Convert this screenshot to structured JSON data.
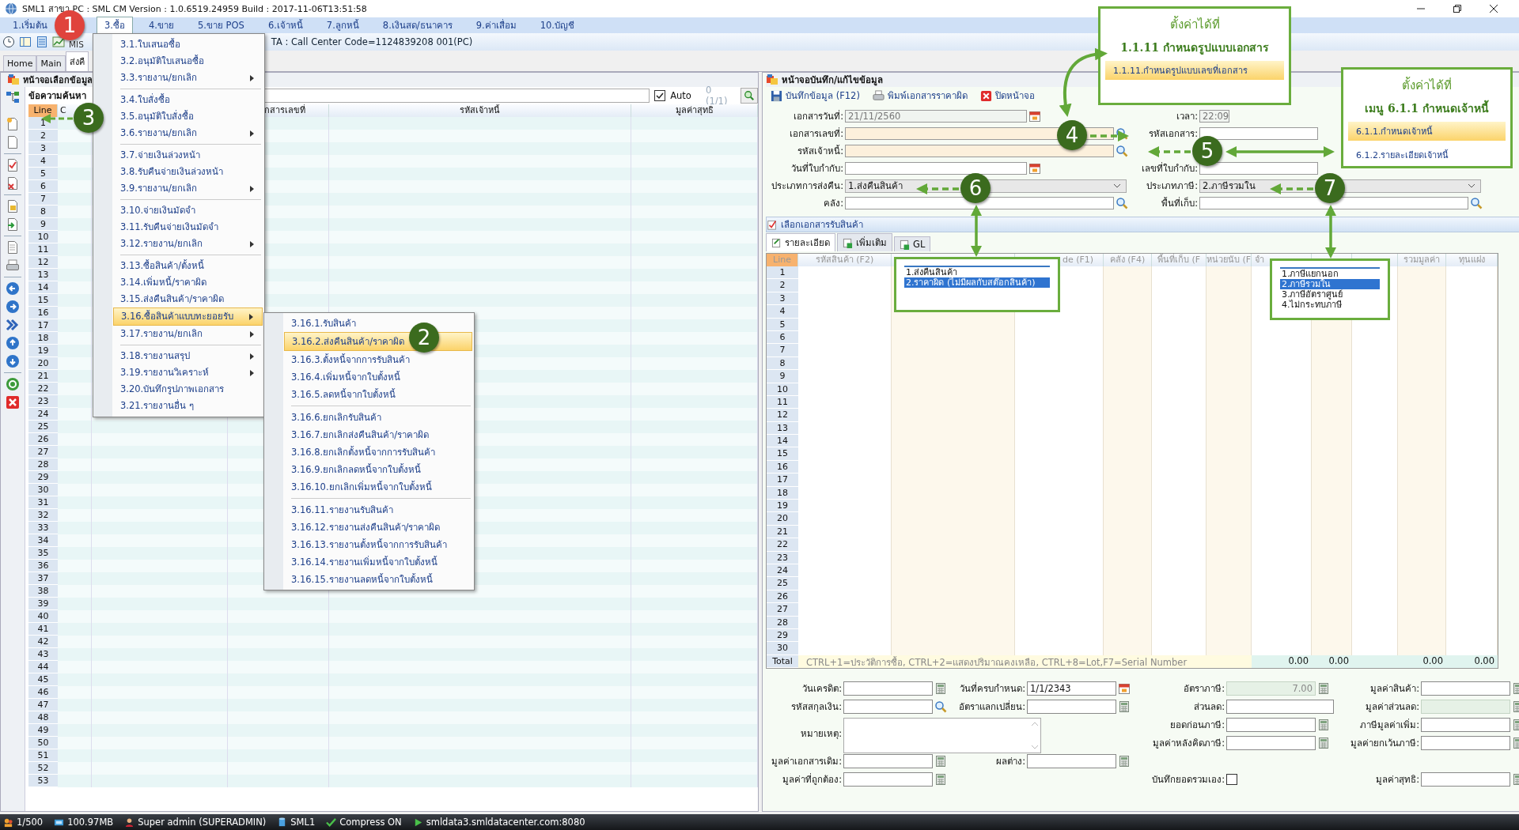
{
  "window": {
    "title": "SML1 สาขา PC : SML CM Version : 1.0.6519.24959  Build : 2017-11-06T13:51:58"
  },
  "menu_bar": [
    {
      "label": "1.เริ่มต้น",
      "selected": false
    },
    {
      "label": "3.ซื้อ",
      "selected": true
    },
    {
      "label": "4.ขาย",
      "selected": false
    },
    {
      "label": "5.ขาย POS",
      "selected": false
    },
    {
      "label": "6.เจ้าหนี้",
      "selected": false
    },
    {
      "label": "7.ลูกหนี้",
      "selected": false
    },
    {
      "label": "8.เงินสด/ธนาคาร",
      "selected": false
    },
    {
      "label": "9.ค่าเสื่อม",
      "selected": false
    },
    {
      "label": "10.บัญชี",
      "selected": false
    }
  ],
  "toolbar": {
    "mis_label": "MIS",
    "info": "TA : Call Center Code=1124839208 001(PC)"
  },
  "tabs": [
    {
      "label": "Home",
      "selected": false
    },
    {
      "label": "Main",
      "selected": false
    },
    {
      "label": "ส่งคื",
      "selected": true
    }
  ],
  "left_panel": {
    "title": "หน้าจอเลือกข้อมูล",
    "search_label": "ข้อความค้นหา",
    "auto": {
      "label": "Auto",
      "checked": true
    },
    "count": "0 (1/1)",
    "columns": [
      {
        "label": "Line"
      },
      {
        "label": "C"
      },
      {},
      {
        "label": "กสารเลขที่"
      },
      {
        "label": "รหัสเจ้าหนี้"
      },
      {
        "label": "มูลค่าสุทธิ"
      }
    ],
    "rows": [
      "1",
      "2",
      "3",
      "4",
      "5",
      "6",
      "7",
      "8",
      "9",
      "10",
      "11",
      "12",
      "13",
      "14",
      "15",
      "16",
      "17",
      "18",
      "19",
      "20",
      "21",
      "22",
      "23",
      "24",
      "25",
      "26",
      "27",
      "28",
      "29",
      "30",
      "31",
      "32",
      "33",
      "34",
      "35",
      "36",
      "37",
      "38",
      "39",
      "40",
      "41",
      "42",
      "43",
      "44",
      "45",
      "46",
      "47",
      "48",
      "49",
      "50",
      "51",
      "52",
      "53"
    ]
  },
  "dropdown_menu": [
    {
      "kind": "item",
      "label": "3.1.ใบเสนอซื้อ",
      "submenu": false,
      "selected": false
    },
    {
      "kind": "item",
      "label": "3.2.อนุมัติใบเสนอซื้อ",
      "submenu": false,
      "selected": false
    },
    {
      "kind": "item",
      "label": "3.3.รายงาน/ยกเลิก",
      "submenu": true,
      "selected": false
    },
    {
      "kind": "separator"
    },
    {
      "kind": "item",
      "label": "3.4.ใบสั่งซื้อ",
      "submenu": false,
      "selected": false
    },
    {
      "kind": "item",
      "label": "3.5.อนุมัติใบสั่งซื้อ",
      "submenu": false,
      "selected": false
    },
    {
      "kind": "item",
      "label": "3.6.รายงาน/ยกเลิก",
      "submenu": true,
      "selected": false
    },
    {
      "kind": "separator"
    },
    {
      "kind": "item",
      "label": "3.7.จ่ายเงินล่วงหน้า",
      "submenu": false,
      "selected": false
    },
    {
      "kind": "item",
      "label": "3.8.รับคืนจ่ายเงินล่วงหน้า",
      "submenu": false,
      "selected": false
    },
    {
      "kind": "item",
      "label": "3.9.รายงาน/ยกเลิก",
      "submenu": true,
      "selected": false
    },
    {
      "kind": "separator"
    },
    {
      "kind": "item",
      "label": "3.10.จ่ายเงินมัดจำ",
      "submenu": false,
      "selected": false
    },
    {
      "kind": "item",
      "label": "3.11.รับคืนจ่ายเงินมัดจำ",
      "submenu": false,
      "selected": false
    },
    {
      "kind": "item",
      "label": "3.12.รายงาน/ยกเลิก",
      "submenu": true,
      "selected": false
    },
    {
      "kind": "separator"
    },
    {
      "kind": "item",
      "label": "3.13.ซื้อสินค้า/ตั้งหนี้",
      "submenu": false,
      "selected": false
    },
    {
      "kind": "item",
      "label": "3.14.เพิ่มหนี้/ราคาผิด",
      "submenu": false,
      "selected": false
    },
    {
      "kind": "item",
      "label": "3.15.ส่งคืนสินค้า/ราคาผิด",
      "submenu": false,
      "selected": false
    },
    {
      "kind": "item",
      "label": "3.16.ซื้อสินค้าแบบทะยอยรับ",
      "submenu": true,
      "selected": true
    },
    {
      "kind": "item",
      "label": "3.17.รายงาน/ยกเลิก",
      "submenu": true,
      "selected": false
    },
    {
      "kind": "separator"
    },
    {
      "kind": "item",
      "label": "3.18.รายงานสรุป",
      "submenu": true,
      "selected": false
    },
    {
      "kind": "item",
      "label": "3.19.รายงานวิเคราะห์",
      "submenu": true,
      "selected": false
    },
    {
      "kind": "item",
      "label": "3.20.บันทึกรูปภาพเอกสาร",
      "submenu": false,
      "selected": false
    },
    {
      "kind": "item",
      "label": "3.21.รายงานอื่น ๆ",
      "submenu": false,
      "selected": false
    }
  ],
  "submenu": [
    {
      "kind": "item",
      "label": "3.16.1.รับสินค้า",
      "selected": false
    },
    {
      "kind": "item",
      "label": "3.16.2.ส่งคืนสินค้า/ราคาผิด",
      "selected": true
    },
    {
      "kind": "item",
      "label": "3.16.3.ตั้งหนี้จากการรับสินค้า",
      "selected": false
    },
    {
      "kind": "item",
      "label": "3.16.4.เพิ่มหนี้จากใบตั้งหนี้",
      "selected": false
    },
    {
      "kind": "item",
      "label": "3.16.5.ลดหนี้จากใบตั้งหนี้",
      "selected": false
    },
    {
      "kind": "separator"
    },
    {
      "kind": "item",
      "label": "3.16.6.ยกเลิกรับสินค้า",
      "selected": false
    },
    {
      "kind": "item",
      "label": "3.16.7.ยกเลิกส่งคืนสินค้า/ราคาผิด",
      "selected": false
    },
    {
      "kind": "item",
      "label": "3.16.8.ยกเลิกตั้งหนี้จากการรับสินค้า",
      "selected": false
    },
    {
      "kind": "item",
      "label": "3.16.9.ยกเลิกลดหนี้จากใบตั้งหนี้",
      "selected": false
    },
    {
      "kind": "item",
      "label": "3.16.10.ยกเลิกเพิ่มหนี้จากใบตั้งหนี้",
      "selected": false
    },
    {
      "kind": "separator"
    },
    {
      "kind": "item",
      "label": "3.16.11.รายงานรับสินค้า",
      "selected": false
    },
    {
      "kind": "item",
      "label": "3.16.12.รายงานส่งคืนสินค้า/ราคาผิด",
      "selected": false
    },
    {
      "kind": "item",
      "label": "3.16.13.รายงานตั้งหนี้จากการรับสินค้า",
      "selected": false
    },
    {
      "kind": "item",
      "label": "3.16.14.รายงานเพิ่มหนี้จากใบตั้งหนี้",
      "selected": false
    },
    {
      "kind": "item",
      "label": "3.16.15.รายงานลดหนี้จากใบตั้งหนี้",
      "selected": false
    }
  ],
  "right_panel": {
    "title": "หน้าจอบันทึก/แก้ไขข้อมูล",
    "buttons": [
      {
        "label": "บันทึกข้อมูล (F12)",
        "kind": "save"
      },
      {
        "label": "พิมพ์เอกสารราคาผิด",
        "kind": "print"
      },
      {
        "label": "ปิดหน้าจอ",
        "kind": "close"
      }
    ],
    "form": [
      {
        "left": {
          "label": "เอกสารวันที่:",
          "value": "21/11/2560",
          "kind": "date",
          "disabled": true,
          "required": false
        },
        "right": {
          "label": "เวลา:",
          "value": "22:09",
          "kind": "time",
          "disabled": true,
          "required": false
        }
      },
      {
        "left": {
          "label": "เอกสารเลขที่:",
          "kind": "lookup",
          "disabled": false,
          "required": true
        },
        "right": {
          "label": "รหัสเอกสาร:",
          "kind": "text",
          "disabled": false,
          "required": false
        }
      },
      {
        "left": {
          "label": "รหัสเจ้าหนี้:",
          "kind": "lookup",
          "disabled": false,
          "required": true
        }
      },
      {
        "left": {
          "label": "วันที่ใบกำกับ:",
          "kind": "date",
          "disabled": false,
          "required": false
        },
        "right": {
          "label": "เลขที่ใบกำกับ:",
          "kind": "text",
          "disabled": false,
          "required": false
        }
      },
      {
        "left": {
          "label": "ประเภทการส่งคืน:",
          "value": "1.ส่งคืนสินค้า",
          "kind": "select"
        },
        "right": {
          "label": "ประเภทภาษี:",
          "value": "2.ภาษีรวมใน",
          "kind": "select"
        }
      },
      {
        "left": {
          "label": "คลัง:",
          "kind": "lookup",
          "disabled": false,
          "required": false
        },
        "right": {
          "label": "พื้นที่เก็บ:",
          "kind": "lookup",
          "disabled": false,
          "required": false
        }
      }
    ],
    "section": "เลือกเอกสารรับสินค้า",
    "tabs": [
      {
        "label": "รายละเอียด",
        "selected": true
      },
      {
        "label": "เพิ่มเติม",
        "selected": false
      },
      {
        "label": "GL",
        "selected": false
      }
    ],
    "columns": [
      {
        "label": "Line"
      },
      {
        "label": "รหัสสินค้า (F2)"
      },
      {},
      {
        "label": "de (F1)"
      },
      {
        "label": "คลัง (F4)"
      },
      {
        "label": "พื้นที่เก็บ (F"
      },
      {
        "label": "หน่วยนับ (F"
      },
      {
        "label": "จำ"
      },
      {},
      {},
      {
        "label": "รวมมูลค่า"
      },
      {
        "label": "ทุนแฝง"
      }
    ],
    "rows": [
      "1",
      "2",
      "3",
      "4",
      "5",
      "6",
      "7",
      "8",
      "9",
      "10",
      "11",
      "12",
      "13",
      "14",
      "15",
      "16",
      "17",
      "18",
      "19",
      "20",
      "21",
      "22",
      "23",
      "24",
      "25",
      "26",
      "27",
      "28",
      "29",
      "30"
    ],
    "total": {
      "label": "Total",
      "hint": "CTRL+1=ประวัติการซื้อ, CTRL+2=แสดงปริมาณคงเหลือ, CTRL+8=Lot,F7=Serial Number",
      "values": [
        "0.00",
        "0.00",
        "0.00",
        "0.00"
      ]
    },
    "summary": [
      {
        "label": "วันเครดิต:",
        "kind": "input",
        "disabled": false
      },
      {
        "label": "วันที่ครบกำหนด:",
        "value": "1/1/2343",
        "kind": "input",
        "disabled": false
      },
      {
        "label": "อัตราภาษี:",
        "value": "7.00",
        "kind": "input",
        "disabled": true
      },
      {
        "label": "มูลค่าสินค้า:",
        "kind": "input",
        "disabled": false
      },
      {
        "label": "รหัสสกุลเงิน:",
        "kind": "input",
        "disabled": false
      },
      {
        "label": "อัตราแลกเปลี่ยน:",
        "kind": "input",
        "disabled": false
      },
      {
        "label": "ส่วนลด:",
        "kind": "input",
        "disabled": false
      },
      {
        "label": "มูลค่าส่วนลด:",
        "kind": "input",
        "disabled": true
      },
      {
        "label": "หมายเหตุ:",
        "kind": "textarea"
      },
      {
        "label": "ยอดก่อนภาษี:",
        "kind": "input",
        "disabled": false
      },
      {
        "label": "ภาษีมูลค่าเพิ่ม:",
        "kind": "input",
        "disabled": false
      },
      {
        "label": "มูลค่าหลังคิดภาษี:",
        "kind": "input",
        "disabled": false
      },
      {
        "label": "มูลค่ายกเว้นภาษี:",
        "kind": "input",
        "disabled": false
      },
      {
        "label": "มูลค่าเอกสารเดิม:",
        "kind": "input",
        "disabled": false
      },
      {
        "label": "ผลต่าง:",
        "kind": "input",
        "disabled": false
      },
      {
        "label": "มูลค่าที่ถูกต้อง:",
        "kind": "input",
        "disabled": false
      },
      {
        "label": "บันทึกยอดรวมเอง:",
        "kind": "checkbox",
        "checked": false
      },
      {
        "label": "มูลค่าสุทธิ:",
        "kind": "input",
        "disabled": false
      }
    ]
  },
  "annotations": {
    "badges": [
      {
        "number": "1",
        "color": "#e0433c"
      },
      {
        "number": "2",
        "color": "#3b6b1e"
      },
      {
        "number": "3",
        "color": "#3b6b1e"
      },
      {
        "number": "4",
        "color": "#3b6b1e"
      },
      {
        "number": "5",
        "color": "#3b6b1e"
      },
      {
        "number": "6",
        "color": "#3b6b1e"
      },
      {
        "number": "7",
        "color": "#3b6b1e"
      }
    ],
    "callouts": [
      {
        "title": "ตั้งค่าได้ที่",
        "subtitle": "1.1.11  กำหนดรูปแบบเอกสาร",
        "items": [
          {
            "label": "1.1.11.กำหนดรูปแบบเลขที่เอกสาร",
            "selected": true
          }
        ]
      },
      {
        "title": "ตั้งค่าได้ที่",
        "subtitle": "เมนู 6.1.1  กำหนดเจ้าหนี้",
        "items": [
          {
            "label": "6.1.1.กำหนดเจ้าหนี้",
            "selected": true
          },
          {
            "label": "6.1.2.รายละเอียดเจ้าหนี้",
            "selected": false
          }
        ]
      }
    ],
    "popups": [
      {
        "items": [
          {
            "label": "1.ส่งคืนสินค้า",
            "selected": false
          },
          {
            "label": "2.ราคาผิด (ไม่มีผลกับสต๊อกสินค้า)",
            "selected": true
          }
        ]
      },
      {
        "items": [
          {
            "label": "1.ภาษีแยกนอก",
            "selected": false
          },
          {
            "label": "2.ภาษีรวมใน",
            "selected": true
          },
          {
            "label": "3.ภาษีอัตราศูนย์",
            "selected": false
          },
          {
            "label": "4.ไม่กระทบภาษี",
            "selected": false
          }
        ]
      }
    ]
  },
  "status_bar": [
    "1/500",
    "100.97MB",
    "Super admin (SUPERADMIN)",
    "SML1",
    "Compress ON",
    "smldata3.smldatacenter.com:8080"
  ]
}
